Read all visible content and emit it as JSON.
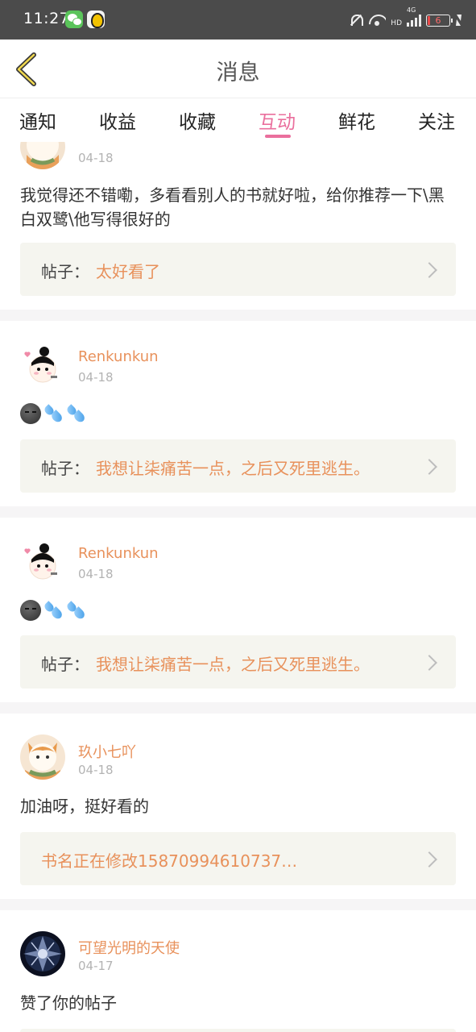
{
  "status_bar": {
    "time": "11:27",
    "battery": "6",
    "network": "4G",
    "hd": "HD"
  },
  "header": {
    "title": "消息"
  },
  "tabs": [
    {
      "label": "通知"
    },
    {
      "label": "收益"
    },
    {
      "label": "收藏"
    },
    {
      "label": "互动",
      "active": true
    },
    {
      "label": "鲜花"
    },
    {
      "label": "关注"
    }
  ],
  "post_prefix": "帖子：",
  "items": [
    {
      "date": "04-18",
      "comment": "我觉得还不错嘞，多看看别人的书就好啦，给你推荐一下\\黑白双鹭\\他写得很好的",
      "post_title": "太好看了"
    },
    {
      "username": "Renkunkun",
      "date": "04-18",
      "emoji": [
        "dark-moon-face",
        "sweat-droplets",
        "sweat-droplets"
      ],
      "post_title": "我想让柒痛苦一点，之后又死里逃生。"
    },
    {
      "username": "Renkunkun",
      "date": "04-18",
      "emoji": [
        "dark-moon-face",
        "sweat-droplets",
        "sweat-droplets"
      ],
      "post_title": "我想让柒痛苦一点，之后又死里逃生。"
    },
    {
      "username": "玖小七吖",
      "date": "04-18",
      "comment": "加油呀，挺好看的",
      "post_title": "书名正在修改15870994610737…"
    },
    {
      "username": "可望光明的天使",
      "date": "04-17",
      "comment": "赞了你的帖子"
    }
  ],
  "colors": {
    "accent_pink": "#ea6f9d",
    "username_orange": "#e8915b",
    "post_box_bg": "#f5f5ef"
  }
}
